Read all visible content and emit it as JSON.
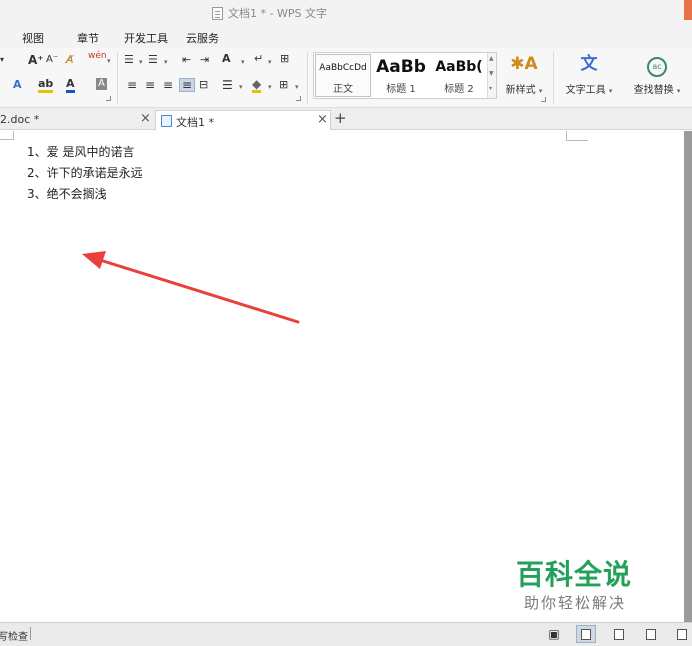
{
  "window": {
    "title": "文档1 * - WPS 文字"
  },
  "menu": {
    "items": [
      "视图",
      "章节",
      "开发工具",
      "云服务"
    ]
  },
  "ribbon": {
    "font_grow_label": "A⁺",
    "font_shrink_label": "A⁻",
    "clear_format_label": "A̸",
    "phonetic_label": "wén",
    "highlight_label": "ab",
    "font_color_label": "A",
    "char_shading_label": "A",
    "text_effect_label": "A",
    "list_bullet_label": "☰",
    "list_number_label": "☰",
    "indent_dec_label": "⇤",
    "indent_inc_label": "⇥",
    "sort_label": "A",
    "show_marks_label": "↵",
    "table_label": "⊞",
    "styles": [
      {
        "preview": "AaBbCcDd",
        "name": "正文"
      },
      {
        "preview": "AaBb",
        "name": "标题 1"
      },
      {
        "preview": "AaBb(",
        "name": "标题 2"
      }
    ],
    "new_style_label": "新样式",
    "text_tools_label": "文字工具",
    "find_replace_label": "查找替换"
  },
  "tabs": [
    {
      "label": "2.doc *",
      "active": false
    },
    {
      "label": "文档1 *",
      "active": true
    }
  ],
  "document": {
    "lines": [
      "1、爱 是风中的诺言",
      "2、许下的承诺是永远",
      "3、绝不会搁浅"
    ]
  },
  "watermark": {
    "main": "百科全说",
    "sub": "助你轻松解决"
  },
  "statusbar": {
    "left_text": "拼写检查"
  },
  "colors": {
    "arrow": "#e8413a",
    "watermark": "#23a05a",
    "font_color_bar": "#1f4fd0",
    "highlight_bar": "#e8c200"
  }
}
